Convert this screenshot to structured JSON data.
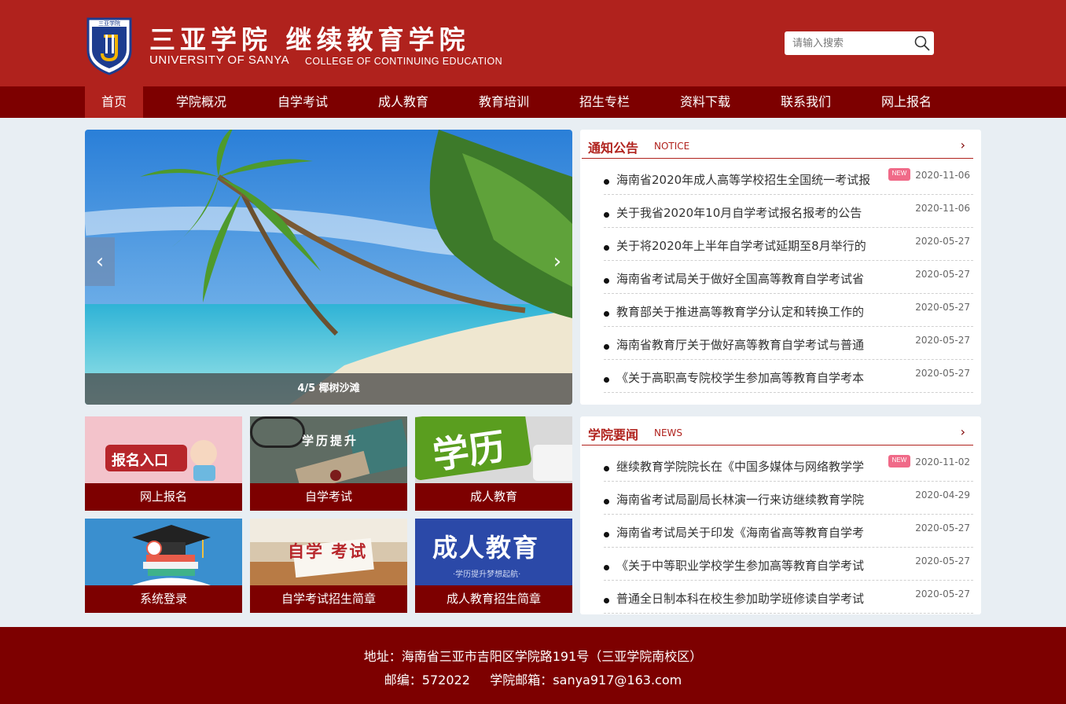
{
  "header": {
    "logo_cn": "三亚学院 继续教育学院",
    "logo_en_university": "UNIVERSITY OF SANYA",
    "logo_en_college": "COLLEGE OF CONTINUING EDUCATION",
    "emblem_top_text": "三亚学院",
    "search_placeholder": "请输入搜索"
  },
  "nav": {
    "items": [
      "首页",
      "学院概况",
      "自学考试",
      "成人教育",
      "教育培训",
      "招生专栏",
      "资料下载",
      "联系我们",
      "网上报名"
    ],
    "active_index": 0
  },
  "slider": {
    "prev_icon": "‹",
    "next_icon": "›",
    "caption": "4/5 椰树沙滩"
  },
  "tiles": [
    {
      "label": "网上报名",
      "image_text": "报名入口"
    },
    {
      "label": "自学考试",
      "image_text": "学历提升"
    },
    {
      "label": "成人教育",
      "image_text": "学历"
    },
    {
      "label": "系统登录"
    },
    {
      "label": "自学考试招生简章",
      "image_text": "自学 考试"
    },
    {
      "label": "成人教育招生简章",
      "image_text": "成人教育",
      "image_sub": "·学历提升梦想起航·"
    }
  ],
  "notice": {
    "title": "通知公告",
    "subtitle": "NOTICE",
    "more": "›",
    "items": [
      {
        "text": "海南省2020年成人高等学校招生全国统一考试报",
        "date": "2020-11-06",
        "new": true
      },
      {
        "text": "关于我省2020年10月自学考试报名报考的公告",
        "date": "2020-11-06",
        "new": false
      },
      {
        "text": "关于将2020年上半年自学考试延期至8月举行的",
        "date": "2020-05-27",
        "new": false
      },
      {
        "text": "海南省考试局关于做好全国高等教育自学考试省",
        "date": "2020-05-27",
        "new": false
      },
      {
        "text": "教育部关于推进高等教育学分认定和转换工作的",
        "date": "2020-05-27",
        "new": false
      },
      {
        "text": "海南省教育厅关于做好高等教育自学考试与普通",
        "date": "2020-05-27",
        "new": false
      },
      {
        "text": "《关于高职高专院校学生参加高等教育自学考本",
        "date": "2020-05-27",
        "new": false
      }
    ]
  },
  "news": {
    "title": "学院要闻",
    "subtitle": "NEWS",
    "more": "›",
    "items": [
      {
        "text": "继续教育学院院长在《中国多媒体与网络教学学",
        "date": "2020-11-02",
        "new": true
      },
      {
        "text": "海南省考试局副局长林演一行来访继续教育学院",
        "date": "2020-04-29",
        "new": false
      },
      {
        "text": "海南省考试局关于印发《海南省高等教育自学考",
        "date": "2020-05-27",
        "new": false
      },
      {
        "text": "《关于中等职业学校学生参加高等教育自学考试",
        "date": "2020-05-27",
        "new": false
      },
      {
        "text": "普通全日制本科在校生参加助学班修读自学考试",
        "date": "2020-05-27",
        "new": false
      }
    ]
  },
  "new_badge": "NEW",
  "footer": {
    "address": "地址：海南省三亚市吉阳区学院路191号（三亚学院南校区）",
    "contact": "邮编：572022     学院邮箱：sanya917@163.com"
  },
  "colors": {
    "brand_red": "#b0221d",
    "dark_red": "#7d0000",
    "page_bg": "#e8eef3",
    "new_badge": "#f06a88"
  }
}
